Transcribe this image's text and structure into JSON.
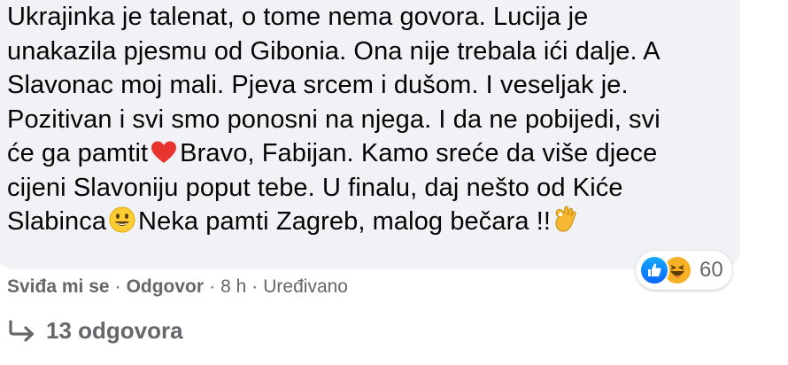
{
  "comment": {
    "lines": [
      "Ukrajinka je talenat, o tome nema govora. Lucija je",
      "unakazila pjesmu od Gibonia. Ona nije trebala ići dalje. A",
      "Slavonac moj mali. Pjeva srcem i dušom. I veseljak je.",
      "Pozitivan i svi smo ponosni na njega. I da ne pobijedi, svi",
      "će ga pamtit",
      "Bravo, Fabijan. Kamo sreće da više djece",
      "cijeni Slavoniju poput tebe. U finalu, daj nešto od Kiće",
      "Slabinca",
      "Neka pamti Zagreb, malog bečara !!"
    ],
    "emojis": [
      "heart-emoji",
      "grinning-emoji",
      "ok-hand-emoji"
    ]
  },
  "reactions": {
    "icons": [
      "like-icon",
      "haha-icon"
    ],
    "count": "60"
  },
  "actions": {
    "like_label": "Sviđa mi se",
    "separator": "·",
    "reply_label": "Odgovor",
    "time": "8 h",
    "edited_label": "Uređivano"
  },
  "replies": {
    "icon": "reply-arrow-icon",
    "label": "13 odgovora"
  },
  "colors": {
    "bubble_bg": "#f0f2f5",
    "text": "#050505",
    "secondary_text": "#65676b",
    "like_blue": "#0866ff",
    "haha_yellow": "#f7b125",
    "heart_red": "#e8342f"
  }
}
